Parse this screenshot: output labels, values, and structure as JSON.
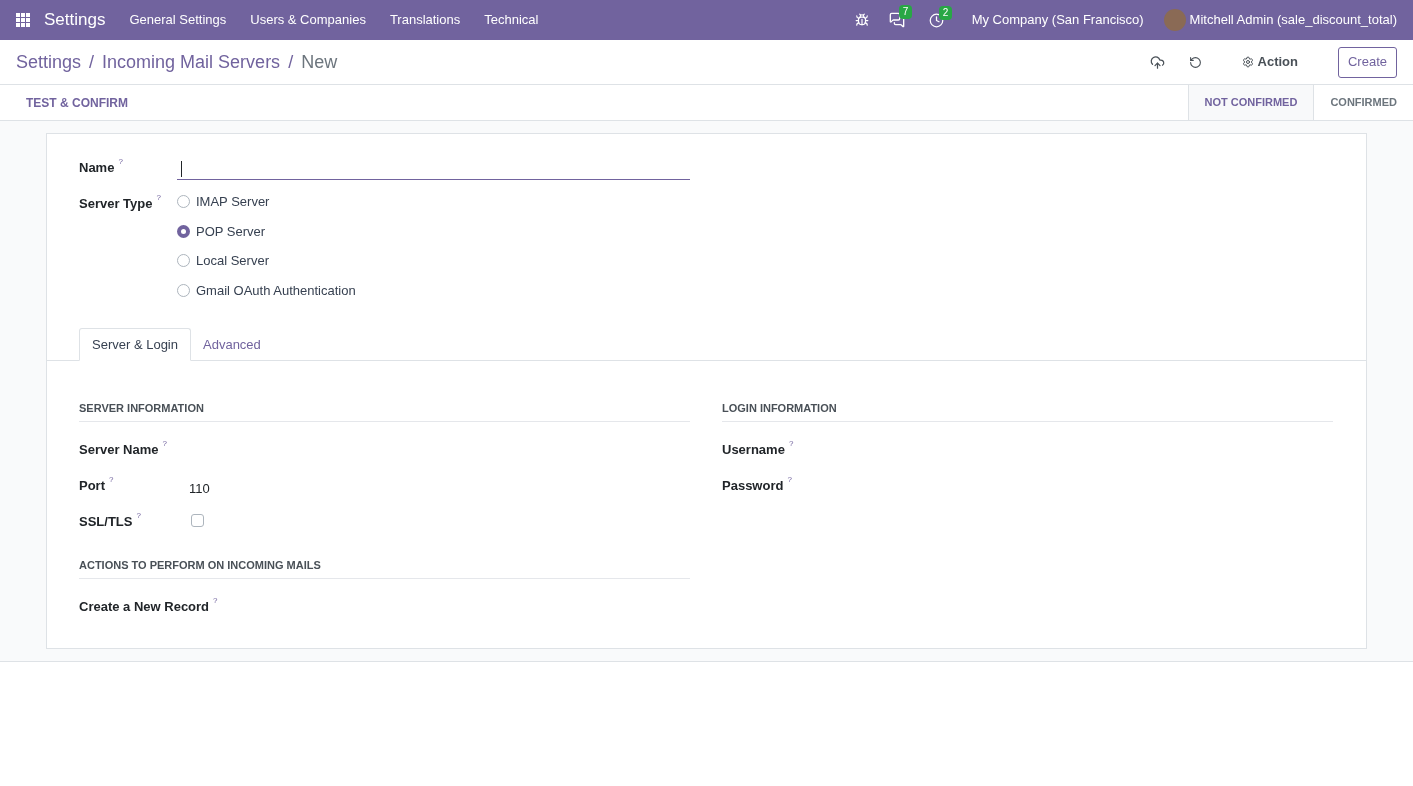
{
  "navbar": {
    "app": "Settings",
    "menu": [
      "General Settings",
      "Users & Companies",
      "Translations",
      "Technical"
    ],
    "messages_count": "7",
    "activities_count": "2",
    "company": "My Company (San Francisco)",
    "user": "Mitchell Admin (sale_discount_total)"
  },
  "breadcrumb": {
    "separator": "/",
    "items": [
      "Settings",
      "Incoming Mail Servers",
      "New"
    ]
  },
  "toolbar": {
    "action": "Action",
    "create": "Create"
  },
  "statusbar": {
    "button": "TEST & CONFIRM",
    "stages": [
      {
        "label": "NOT CONFIRMED",
        "selected": true
      },
      {
        "label": "CONFIRMED",
        "selected": false
      }
    ]
  },
  "form": {
    "name": {
      "label": "Name",
      "help": "?"
    },
    "server_type": {
      "label": "Server Type",
      "help": "?",
      "options": [
        {
          "label": "IMAP Server",
          "selected": false
        },
        {
          "label": "POP Server",
          "selected": true
        },
        {
          "label": "Local Server",
          "selected": false
        },
        {
          "label": "Gmail OAuth Authentication",
          "selected": false
        }
      ]
    },
    "tabs": [
      {
        "label": "Server & Login",
        "selected": true
      },
      {
        "label": "Advanced",
        "selected": false
      }
    ],
    "left_groups": [
      {
        "title": "SERVER INFORMATION",
        "fields": [
          {
            "kind": "text",
            "label": "Server Name",
            "help": "?"
          },
          {
            "kind": "text",
            "label": "Port",
            "help": "?",
            "value": "110"
          },
          {
            "kind": "checkbox",
            "label": "SSL/TLS",
            "help": "?",
            "checked": false
          }
        ]
      },
      {
        "title": "ACTIONS TO PERFORM ON INCOMING MAILS",
        "fields": [
          {
            "kind": "text",
            "label": "Create a New Record",
            "help": "?"
          }
        ]
      }
    ],
    "right_groups": [
      {
        "title": "LOGIN INFORMATION",
        "fields": [
          {
            "kind": "text",
            "label": "Username",
            "help": "?"
          },
          {
            "kind": "text",
            "label": "Password",
            "help": "?"
          }
        ]
      }
    ]
  }
}
